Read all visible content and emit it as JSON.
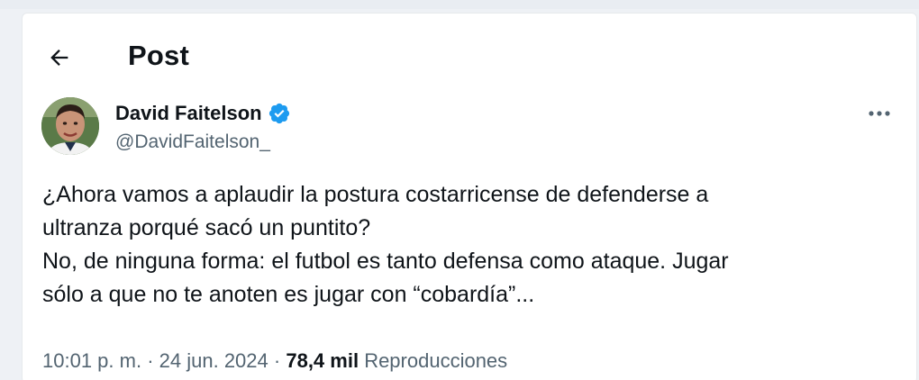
{
  "header": {
    "title": "Post",
    "back_icon": "arrow-left-icon"
  },
  "author": {
    "name": "David Faitelson",
    "handle": "@DavidFaitelson_",
    "verified_icon": "verified-badge-icon",
    "verified_color": "#1d9bf0"
  },
  "more_icon": "more-horizontal-icon",
  "post": {
    "lines": [
      "¿Ahora vamos a aplaudir la postura costarricense de defenderse a",
      "ultranza porqué sacó un puntito?",
      "No, de ninguna forma: el futbol es tanto defensa como ataque. Jugar",
      "sólo a que no te anoten es jugar con “cobardía”..."
    ]
  },
  "meta": {
    "time": "10:01 p. m.",
    "separator": "·",
    "date": "24 jun. 2024",
    "views_count": "78,4 mil",
    "views_label": "Reproducciones"
  }
}
